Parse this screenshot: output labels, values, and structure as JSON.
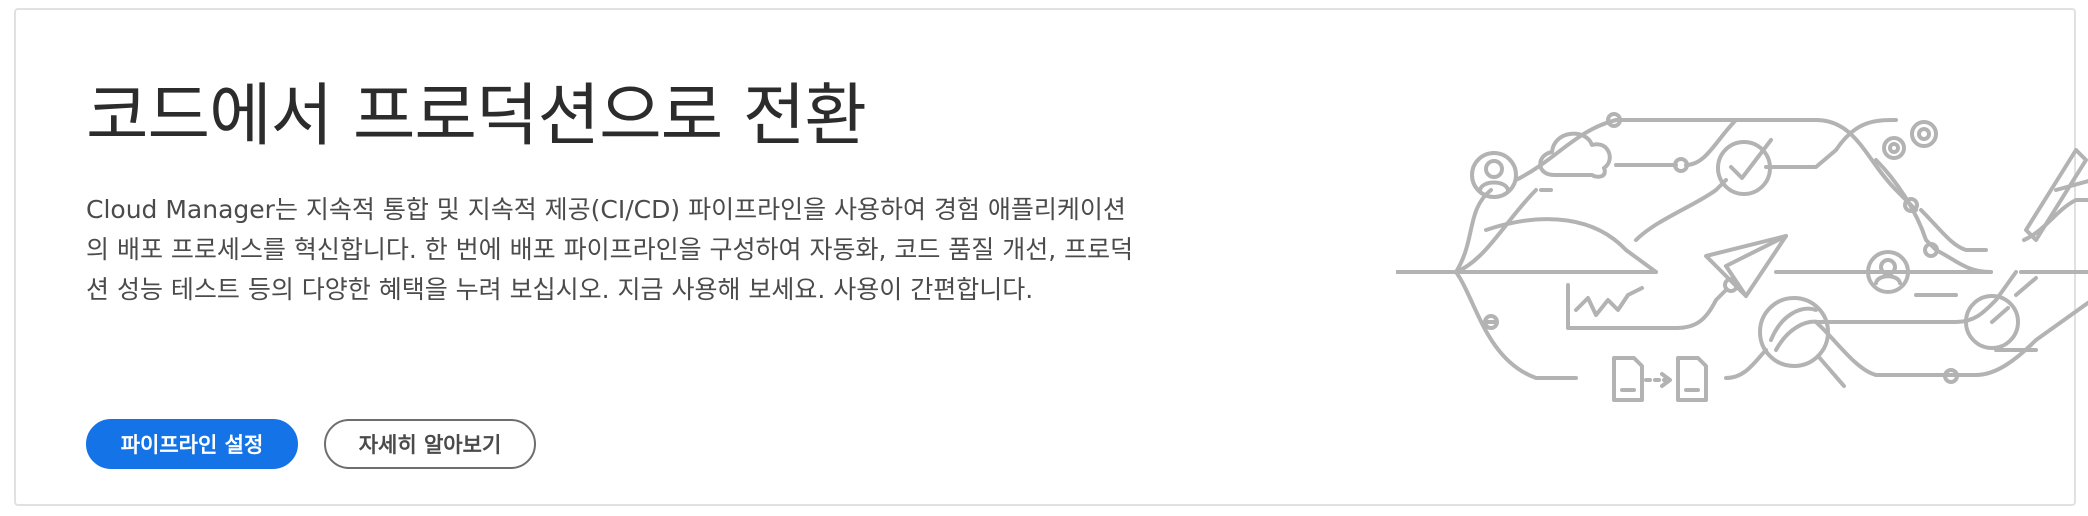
{
  "hero": {
    "title": "코드에서 프로덕션으로 전환",
    "description": "Cloud Manager는 지속적 통합 및 지속적 제공(CI/CD) 파이프라인을 사용하여 경험 애플리케이션의 배포 프로세스를 혁신합니다. 한 번에 배포 파이프라인을 구성하여 자동화, 코드 품질 개선, 프로덕션 성능 테스트 등의 다양한 혜택을 누려 보십시오. 지금 사용해 보세요. 사용이 간편합니다.",
    "primary_button": "파이프라인 설정",
    "secondary_button": "자세히 알아보기"
  },
  "illustration": {
    "icons": [
      "user-icon",
      "cloud-icon",
      "checkmark-icon",
      "gears-icon",
      "pen-icon",
      "paper-plane-icon",
      "chart-icon",
      "user-icon",
      "magnifier-icon",
      "gauge-icon",
      "document-icon",
      "document-icon"
    ]
  },
  "colors": {
    "primary": "#1473e6",
    "heading": "#2c2c2c",
    "body_text": "#4b4b4b",
    "illustration": "#b3b3b3",
    "card_border": "#e1e1e1"
  }
}
